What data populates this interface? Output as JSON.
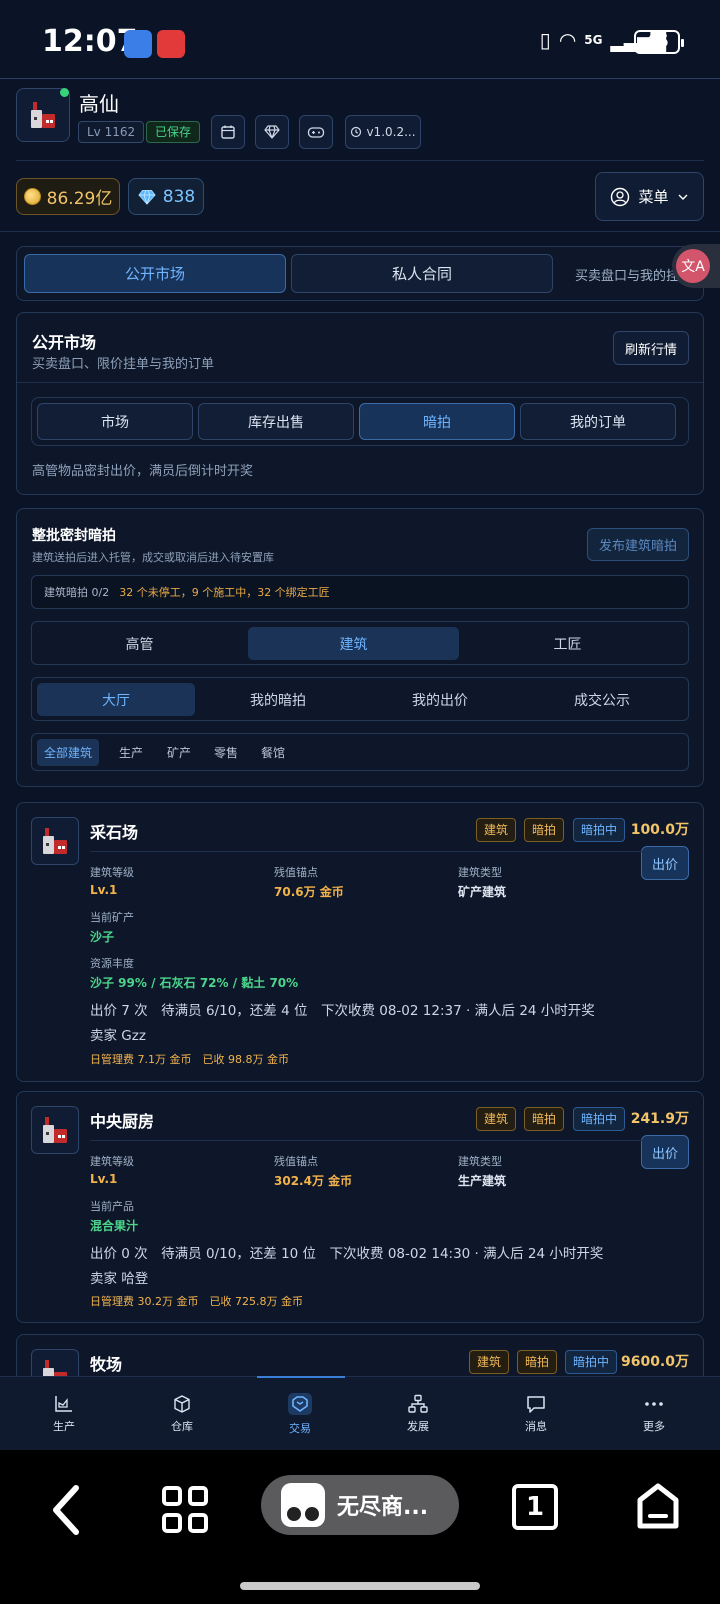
{
  "status_bar": {
    "time": "12:07",
    "network": "5G",
    "battery": "45"
  },
  "header": {
    "username": "高仙",
    "level": "Lv 1162",
    "saved_label": "已保存",
    "version": "v1.0.2...",
    "gold": "86.29亿",
    "gems": "838",
    "menu_label": "菜单"
  },
  "main_tabs": {
    "items": [
      "公开市场",
      "私人合同"
    ],
    "active": "公开市场",
    "description": "买卖盘口与我的挂"
  },
  "market_panel": {
    "title": "公开市场",
    "subtitle": "买卖盘口、限价挂单与我的订单",
    "refresh_label": "刷新行情",
    "tabs": [
      "市场",
      "库存出售",
      "暗拍",
      "我的订单"
    ],
    "active_tab": "暗拍",
    "note": "高管物品密封出价，满员后倒计时开奖"
  },
  "auction_panel": {
    "title": "整批密封暗拍",
    "subtitle": "建筑送拍后进入托管，成交或取消后进入待安置库",
    "publish_label": "发布建筑暗拍",
    "slot_label": "建筑暗拍 0/2",
    "slot_detail": "32 个未停工，9 个施工中，32 个绑定工匠",
    "categories": [
      "高管",
      "建筑",
      "工匠"
    ],
    "active_category": "建筑",
    "views": [
      "大厅",
      "我的暗拍",
      "我的出价",
      "成交公示"
    ],
    "active_view": "大厅",
    "filters": [
      "全部建筑",
      "生产",
      "矿产",
      "零售",
      "餐馆"
    ],
    "active_filter": "全部建筑"
  },
  "listing_labels": {
    "level": "建筑等级",
    "anchor": "残值锚点",
    "type": "建筑类型",
    "bid_button": "出价"
  },
  "listings": [
    {
      "name": "采石场",
      "tags": [
        "建筑",
        "暗拍",
        "暗拍中"
      ],
      "price": "100.0万",
      "level": "Lv.1",
      "anchor": "70.6万 金币",
      "type": "矿产建筑",
      "current_label": "当前矿产",
      "current_value": "沙子",
      "richness_label": "资源丰度",
      "richness_value": "沙子 99% / 石灰石 72% / 黏土 70%",
      "bids_line": "出价 7 次　待满员 6/10，还差 4 位　下次收费 08-02 12:37 · 满人后 24 小时开奖",
      "seller": "卖家 Gzz",
      "fee_line": "日管理费 7.1万 金币　已收 98.8万 金币"
    },
    {
      "name": "中央厨房",
      "tags": [
        "建筑",
        "暗拍",
        "暗拍中"
      ],
      "price": "241.9万",
      "level": "Lv.1",
      "anchor": "302.4万 金币",
      "type": "生产建筑",
      "current_label": "当前产品",
      "current_value": "混合果汁",
      "bids_line": "出价 0 次　待满员 0/10，还差 10 位　下次收费 08-02 14:30 · 满人后 24 小时开奖",
      "seller": "卖家 哈登",
      "fee_line": "日管理费 30.2万 金币　已收 725.8万 金币"
    },
    {
      "name": "牧场",
      "tags": [
        "建筑",
        "暗拍",
        "暗拍中"
      ],
      "price": "9600.0万"
    }
  ],
  "bottom_nav": {
    "items": [
      "生产",
      "仓库",
      "交易",
      "发展",
      "消息",
      "更多"
    ],
    "active": "交易"
  },
  "system_nav": {
    "app_label": "无尽商..."
  },
  "colors": {
    "accent": "#6fb4ff",
    "gold": "#f2b34c",
    "green": "#4cd58c",
    "background": "#0b1426"
  }
}
